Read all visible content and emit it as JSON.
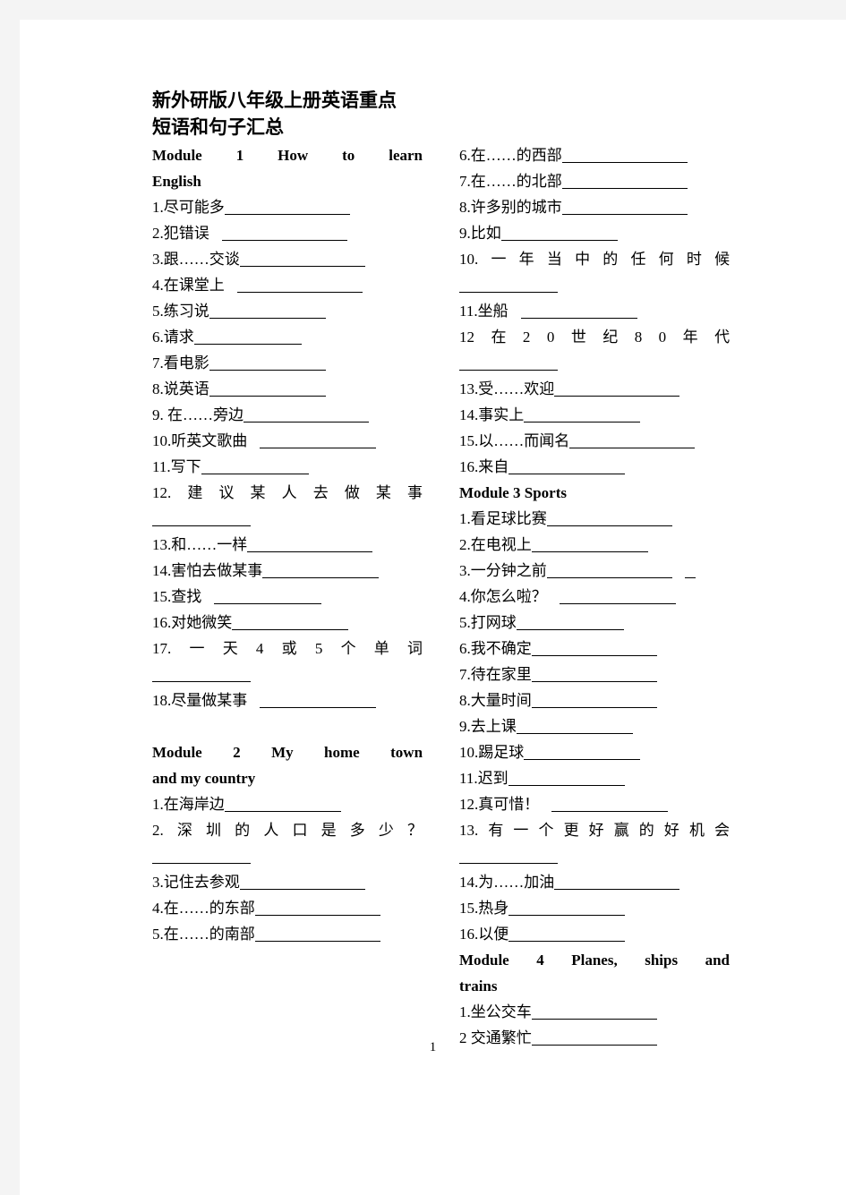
{
  "document": {
    "title_line1": "新外研版八年级上册英语重点",
    "title_line2": "短语和句子汇总",
    "page_number": "1"
  },
  "left_column": {
    "module1": {
      "heading_words": [
        "Module",
        "1",
        "How",
        "to",
        "learn"
      ],
      "heading_line2": "English",
      "items": [
        {
          "num": "1.",
          "text": "尽可能多",
          "blank": "w140"
        },
        {
          "num": "2.",
          "text": "犯错误",
          "gap": true,
          "blank": "w140"
        },
        {
          "num": "3.",
          "text": "跟……交谈",
          "blank": "w140"
        },
        {
          "num": "4.",
          "text": "在课堂上",
          "gap": true,
          "blank": "w140"
        },
        {
          "num": "5.",
          "text": "练习说",
          "blank": "w130"
        },
        {
          "num": "6.",
          "text": "请求",
          "blank": "w120"
        },
        {
          "num": "7.",
          "text": "看电影",
          "blank": "w130"
        },
        {
          "num": "8.",
          "text": "说英语",
          "blank": "w130"
        },
        {
          "num": "9.",
          "text": " 在……旁边",
          "blank": "w140"
        },
        {
          "num": "10.",
          "text": "听英文歌曲",
          "gap": true,
          "blank": "w130"
        },
        {
          "num": "11.",
          "text": "写下",
          "blank": "w120"
        },
        {
          "num": "12.",
          "justified_text": "建议某人去做某事",
          "blank": "w110"
        },
        {
          "num": "13.",
          "text": "和……一样",
          "blank": "w140"
        },
        {
          "num": "14.",
          "text": "害怕去做某事",
          "blank": "w130"
        },
        {
          "num": "15.",
          "text": "查找",
          "gap": true,
          "blank": "w120"
        },
        {
          "num": "16.",
          "text": "对她微笑",
          "blank": "w130"
        },
        {
          "num": "17.",
          "justified_text": "一天 4 或 5 个单词",
          "blank": "w110"
        },
        {
          "num": "18.",
          "text": "尽量做某事",
          "gap": true,
          "blank": "w130"
        }
      ]
    },
    "module2": {
      "heading_words": [
        "Module",
        "2",
        "My",
        "home",
        "town"
      ],
      "heading_line2": "and my country",
      "items": [
        {
          "num": "1.",
          "text": "在海岸边",
          "blank": "w130"
        },
        {
          "num": "2.",
          "justified_text": "深圳的人口是多少？",
          "blank": "w110"
        },
        {
          "num": "3.",
          "text": "记住去参观",
          "blank": "w140"
        },
        {
          "num": "4.",
          "text": "在……的东部",
          "blank": "w140"
        },
        {
          "num": "5.",
          "text": "在……的南部",
          "blank": "w140"
        }
      ]
    }
  },
  "right_column": {
    "module2_cont": {
      "items": [
        {
          "num": "6.",
          "text": "在……的西部",
          "blank": "w140"
        },
        {
          "num": "7.",
          "text": "在……的北部",
          "blank": "w140"
        },
        {
          "num": "8.",
          "text": "许多别的城市",
          "blank": "w140"
        },
        {
          "num": "9.",
          "text": "比如",
          "blank": "w130"
        },
        {
          "num": "10.",
          "justified_text": "一年当中的任何时候",
          "blank": "w110"
        },
        {
          "num": "11.",
          "text": "坐船",
          "gap": true,
          "blank": "w130"
        },
        {
          "num": "12",
          "justified_text": "在 20 世纪 80 年代",
          "blank": "w110"
        },
        {
          "num": "13.",
          "text": "受……欢迎",
          "blank": "w140"
        },
        {
          "num": "14.",
          "text": "事实上",
          "blank": "w130"
        },
        {
          "num": "15.",
          "text": "以……而闻名",
          "blank": "w140"
        },
        {
          "num": "16.",
          "text": "来自",
          "blank": "w130"
        }
      ]
    },
    "module3": {
      "heading_words": [
        "Module",
        "3",
        "Sports"
      ],
      "items": [
        {
          "num": "1.",
          "text": "看足球比赛",
          "blank": "w140"
        },
        {
          "num": "2.",
          "text": "在电视上",
          "blank": "w130"
        },
        {
          "num": "3.",
          "text": "一分钟之前",
          "blank": "w140",
          "extra_blank": true
        },
        {
          "num": "4.",
          "text": "你怎么啦？",
          "gap": true,
          "blank": "w130"
        },
        {
          "num": "5.",
          "text": "打网球",
          "blank": "w120"
        },
        {
          "num": "6.",
          "text": "我不确定",
          "blank": "w140"
        },
        {
          "num": "7.",
          "text": "待在家里",
          "blank": "w140"
        },
        {
          "num": "8.",
          "text": "大量时间",
          "blank": "w140"
        },
        {
          "num": "9.",
          "text": "去上课",
          "blank": "w130"
        },
        {
          "num": "10.",
          "text": "踢足球",
          "blank": "w130"
        },
        {
          "num": "11.",
          "text": "迟到",
          "blank": "w130"
        },
        {
          "num": "12.",
          "text": "真可惜！",
          "gap": true,
          "blank": "w130"
        },
        {
          "num": "13.",
          "justified_text": "有一个更好赢的好机会",
          "blank": "w110"
        },
        {
          "num": "14.",
          "text": "为……加油",
          "blank": "w140"
        },
        {
          "num": "15.",
          "text": "热身",
          "blank": "w130"
        },
        {
          "num": "16.",
          "text": "以便",
          "blank": "w130"
        }
      ]
    },
    "module4": {
      "heading_words": [
        "Module",
        "4",
        "Planes,",
        "ships",
        "and"
      ],
      "heading_line2": "trains",
      "items": [
        {
          "num": "1.",
          "text": "坐公交车",
          "blank": "w140"
        },
        {
          "num": "2",
          "text": " 交通繁忙",
          "blank": "w140"
        }
      ]
    }
  }
}
